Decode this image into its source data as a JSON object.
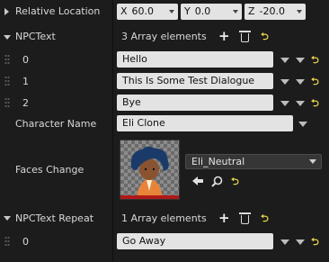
{
  "relative_location": {
    "label": "Relative Location",
    "x": {
      "axis": "X",
      "value": "60.0"
    },
    "y": {
      "axis": "Y",
      "value": "0.0"
    },
    "z": {
      "axis": "Z",
      "value": "-20.0"
    }
  },
  "npc_text": {
    "label": "NPCText",
    "count": "3 Array elements",
    "items": [
      {
        "index": "0",
        "value": "Hello"
      },
      {
        "index": "1",
        "value": "This Is Some Test Dialogue"
      },
      {
        "index": "2",
        "value": "Bye"
      }
    ]
  },
  "character_name": {
    "label": "Character Name",
    "value": "Eli Clone"
  },
  "faces_change": {
    "label": "Faces Change",
    "selected": "Eli_Neutral"
  },
  "npc_text_repeat": {
    "label": "NPCText Repeat",
    "count": "1 Array elements",
    "items": [
      {
        "index": "0",
        "value": "Go Away"
      }
    ]
  },
  "icons": {
    "add": "plus-icon",
    "delete": "trash-icon",
    "reset": "reset-to-default-icon",
    "browse": "arrow-left-icon",
    "find": "magnifier-icon"
  },
  "colors": {
    "background": "#1c1c1c",
    "field": "#e3e3e3",
    "reset_accent": "#e7d44a"
  }
}
